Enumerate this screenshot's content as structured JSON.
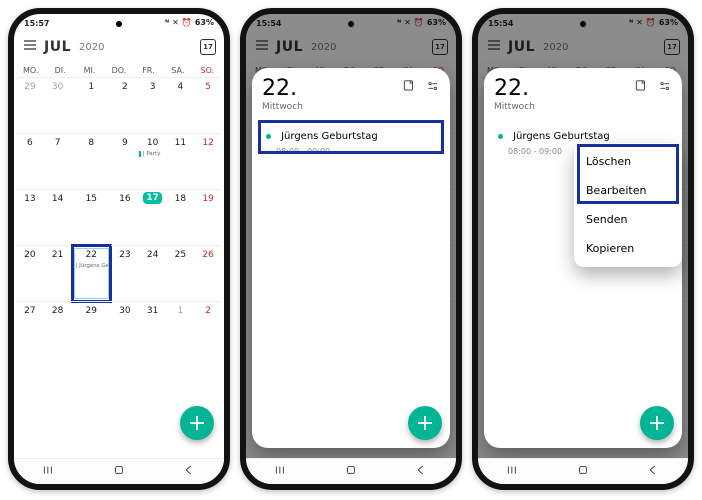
{
  "status": {
    "time1": "15:57",
    "time2": "15:54",
    "time3": "15:54",
    "battery": "63%"
  },
  "header": {
    "month": "JUL",
    "year": "2020",
    "today_num": "17"
  },
  "daynames": [
    "MO.",
    "DI.",
    "MI.",
    "DO.",
    "FR.",
    "SA.",
    "SO."
  ],
  "weeks": [
    [
      {
        "n": "29",
        "o": true
      },
      {
        "n": "30",
        "o": true
      },
      {
        "n": "1"
      },
      {
        "n": "2"
      },
      {
        "n": "3"
      },
      {
        "n": "4"
      },
      {
        "n": "5",
        "s": true
      }
    ],
    [
      {
        "n": "6"
      },
      {
        "n": "7"
      },
      {
        "n": "8"
      },
      {
        "n": "9"
      },
      {
        "n": "10",
        "ev": "| Party"
      },
      {
        "n": "11"
      },
      {
        "n": "12",
        "s": true
      }
    ],
    [
      {
        "n": "13"
      },
      {
        "n": "14"
      },
      {
        "n": "15"
      },
      {
        "n": "16"
      },
      {
        "n": "17",
        "today": true
      },
      {
        "n": "18"
      },
      {
        "n": "19",
        "s": true
      }
    ],
    [
      {
        "n": "20"
      },
      {
        "n": "21"
      },
      {
        "n": "22",
        "ev": "| Jürgens Ge",
        "hl": true,
        "sel": true
      },
      {
        "n": "23"
      },
      {
        "n": "24"
      },
      {
        "n": "25"
      },
      {
        "n": "26",
        "s": true
      }
    ],
    [
      {
        "n": "27"
      },
      {
        "n": "28"
      },
      {
        "n": "29"
      },
      {
        "n": "30"
      },
      {
        "n": "31"
      },
      {
        "n": "1",
        "o": true
      },
      {
        "n": "2",
        "o": true,
        "s": true
      }
    ]
  ],
  "sheet": {
    "daynum": "22.",
    "dayname": "Mittwoch",
    "event_title": "Jürgens Geburtstag",
    "event_time": "08:00 - 09:00"
  },
  "context": {
    "delete": "Löschen",
    "edit": "Bearbeiten",
    "send": "Senden",
    "copy": "Kopieren"
  }
}
